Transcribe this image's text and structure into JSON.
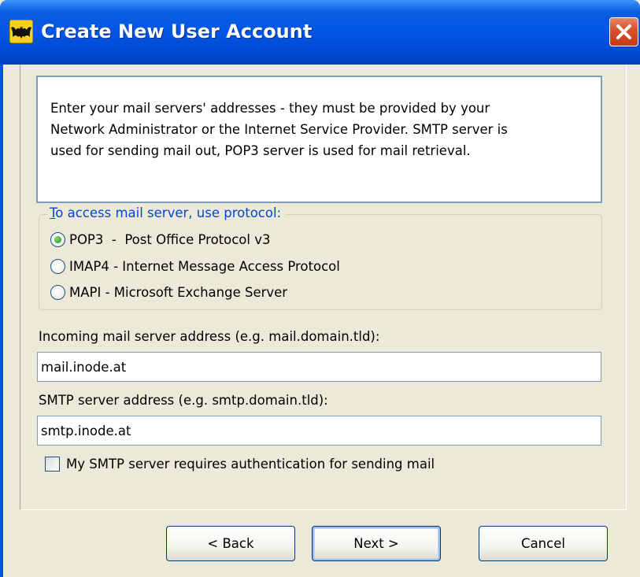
{
  "window": {
    "title": "Create New User Account",
    "close_icon": "close-x-icon",
    "app_icon": "bat-icon",
    "accent_color": "#0054e3"
  },
  "info": {
    "text_line1": "Enter your mail servers' addresses - they must be provided by your",
    "text_line2": "Network Administrator or the Internet Service Provider. SMTP server is",
    "text_line3": "used for sending mail out, POP3 server is used for mail retrieval."
  },
  "protocol": {
    "group_label": "To access mail server, use protocol:",
    "options": [
      {
        "label": "POP3  -  Post Office Protocol v3",
        "checked": true
      },
      {
        "label": "IMAP4 - Internet Message Access Protocol",
        "checked": false
      },
      {
        "label": "MAPI - Microsoft Exchange Server",
        "checked": false
      }
    ]
  },
  "incoming": {
    "label": "Incoming mail server address (e.g. mail.domain.tld):",
    "value": "mail.inode.at"
  },
  "smtp": {
    "label": "SMTP server address (e.g. smtp.domain.tld):",
    "value": "smtp.inode.at"
  },
  "auth": {
    "label": "My SMTP server requires authentication for sending mail",
    "checked": false
  },
  "buttons": {
    "back_label": "< Back",
    "next_label": "Next >",
    "cancel_label": "Cancel"
  }
}
